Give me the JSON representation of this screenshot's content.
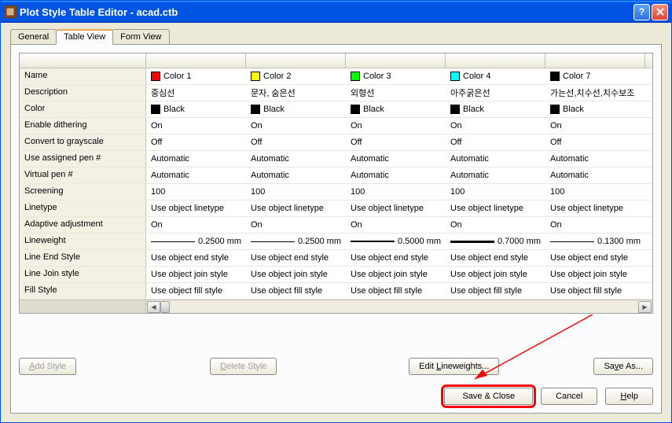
{
  "title": "Plot Style Table Editor - acad.ctb",
  "tabs": [
    "General",
    "Table View",
    "Form View"
  ],
  "rows": [
    {
      "label": "Name",
      "type": "swatch",
      "cells": [
        {
          "color": "#ff0000",
          "text": "Color 1"
        },
        {
          "color": "#ffff00",
          "text": "Color 2"
        },
        {
          "color": "#00ff00",
          "text": "Color 3"
        },
        {
          "color": "#00ffff",
          "text": "Color 4"
        },
        {
          "color": "#000000",
          "text": "Color 7"
        }
      ]
    },
    {
      "label": "Description",
      "type": "plain",
      "cells": [
        {
          "text": "중심선"
        },
        {
          "text": "문자, 숨은선"
        },
        {
          "text": "외형선"
        },
        {
          "text": "아주굵은선"
        },
        {
          "text": "가는선,치수선,치수보조"
        }
      ]
    },
    {
      "label": "Color",
      "type": "swatch",
      "cells": [
        {
          "color": "#000000",
          "text": "Black"
        },
        {
          "color": "#000000",
          "text": "Black"
        },
        {
          "color": "#000000",
          "text": "Black"
        },
        {
          "color": "#000000",
          "text": "Black"
        },
        {
          "color": "#000000",
          "text": "Black"
        }
      ]
    },
    {
      "label": "Enable dithering",
      "type": "plain",
      "cells": [
        {
          "text": "On"
        },
        {
          "text": "On"
        },
        {
          "text": "On"
        },
        {
          "text": "On"
        },
        {
          "text": "On"
        }
      ]
    },
    {
      "label": "Convert to grayscale",
      "type": "plain",
      "cells": [
        {
          "text": "Off"
        },
        {
          "text": "Off"
        },
        {
          "text": "Off"
        },
        {
          "text": "Off"
        },
        {
          "text": "Off"
        }
      ]
    },
    {
      "label": "Use assigned pen #",
      "type": "plain",
      "cells": [
        {
          "text": "Automatic"
        },
        {
          "text": "Automatic"
        },
        {
          "text": "Automatic"
        },
        {
          "text": "Automatic"
        },
        {
          "text": "Automatic"
        }
      ]
    },
    {
      "label": "Virtual pen #",
      "type": "plain",
      "cells": [
        {
          "text": "Automatic"
        },
        {
          "text": "Automatic"
        },
        {
          "text": "Automatic"
        },
        {
          "text": "Automatic"
        },
        {
          "text": "Automatic"
        }
      ]
    },
    {
      "label": "Screening",
      "type": "plain",
      "cells": [
        {
          "text": "100"
        },
        {
          "text": "100"
        },
        {
          "text": "100"
        },
        {
          "text": "100"
        },
        {
          "text": "100"
        }
      ]
    },
    {
      "label": "Linetype",
      "type": "plain",
      "cells": [
        {
          "text": "Use object linetype"
        },
        {
          "text": "Use object linetype"
        },
        {
          "text": "Use object linetype"
        },
        {
          "text": "Use object linetype"
        },
        {
          "text": "Use object linetype"
        }
      ]
    },
    {
      "label": "Adaptive adjustment",
      "type": "plain",
      "cells": [
        {
          "text": "On"
        },
        {
          "text": "On"
        },
        {
          "text": "On"
        },
        {
          "text": "On"
        },
        {
          "text": "On"
        }
      ]
    },
    {
      "label": "Lineweight",
      "type": "lineweight",
      "cells": [
        {
          "w": 1,
          "text": "0.2500 mm"
        },
        {
          "w": 1,
          "text": "0.2500 mm"
        },
        {
          "w": 2,
          "text": "0.5000 mm"
        },
        {
          "w": 3,
          "text": "0.7000 mm"
        },
        {
          "w": 1,
          "text": "0.1300 mm"
        }
      ]
    },
    {
      "label": "Line End Style",
      "type": "plain",
      "cells": [
        {
          "text": "Use object end style"
        },
        {
          "text": "Use object end style"
        },
        {
          "text": "Use object end style"
        },
        {
          "text": "Use object end style"
        },
        {
          "text": "Use object end style"
        }
      ]
    },
    {
      "label": "Line Join style",
      "type": "plain",
      "cells": [
        {
          "text": "Use object join style"
        },
        {
          "text": "Use object join style"
        },
        {
          "text": "Use object join style"
        },
        {
          "text": "Use object join style"
        },
        {
          "text": "Use object join style"
        }
      ]
    },
    {
      "label": "Fill Style",
      "type": "plain",
      "cells": [
        {
          "text": "Use object fill style"
        },
        {
          "text": "Use object fill style"
        },
        {
          "text": "Use object fill style"
        },
        {
          "text": "Use object fill style"
        },
        {
          "text": "Use object fill style"
        }
      ]
    }
  ],
  "buttons": {
    "addStyle": "Add Style",
    "deleteStyle": "Delete Style",
    "editLw": "Edit Lineweights...",
    "saveAs": "Save As...",
    "saveClose": "Save & Close",
    "cancel": "Cancel",
    "help": "Help"
  }
}
